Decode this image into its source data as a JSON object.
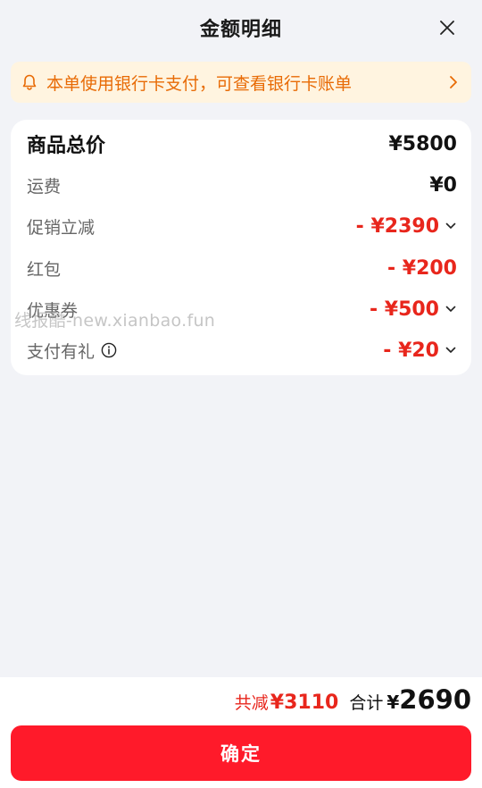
{
  "header": {
    "title": "金额明细",
    "close_icon": "close-icon"
  },
  "notice": {
    "text": "本单使用银行卡支付，可查看银行卡账单",
    "icon": "bell-icon",
    "color": "#e86b06",
    "background": "#fff4e0"
  },
  "breakdown": {
    "total": {
      "label": "商品总价",
      "amount": "¥5800"
    },
    "shipping": {
      "label": "运费",
      "amount": "¥0"
    },
    "promo": {
      "label": "促销立减",
      "amount": "- ¥2390",
      "expandable": true
    },
    "redpacket": {
      "label": "红包",
      "amount": "- ¥200"
    },
    "coupon": {
      "label": "优惠券",
      "amount": "- ¥500",
      "expandable": true
    },
    "paygift": {
      "label": "支付有礼",
      "amount": "- ¥20",
      "expandable": true,
      "icon": "info-icon"
    }
  },
  "watermark": "线报酷-new.xianbao.fun",
  "footer": {
    "reduce_label": "共减",
    "reduce_value": "¥3110",
    "total_label": "合计",
    "currency": "¥",
    "total_value": "2690",
    "confirm_label": "确定"
  },
  "colors": {
    "accent": "#ff1a2a",
    "discount": "#e8261c",
    "background": "#f2f3f7"
  }
}
